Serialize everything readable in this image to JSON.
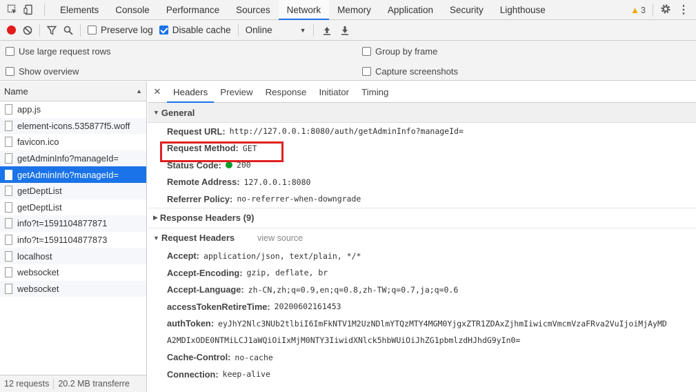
{
  "devtools": {
    "tabs": [
      "Elements",
      "Console",
      "Performance",
      "Sources",
      "Network",
      "Memory",
      "Application",
      "Security",
      "Lighthouse"
    ],
    "active_tab": "Network",
    "warning_count": "3"
  },
  "toolbar": {
    "preserve_log": "Preserve log",
    "disable_cache": "Disable cache",
    "throttle": "Online"
  },
  "settings": {
    "large_rows": "Use large request rows",
    "show_overview": "Show overview",
    "group_by_frame": "Group by frame",
    "capture_screenshots": "Capture screenshots"
  },
  "request_list": {
    "column": "Name",
    "items": [
      "app.js",
      "element-icons.535877f5.woff",
      "favicon.ico",
      "getAdminInfo?manageId=",
      "getAdminInfo?manageId=",
      "getDeptList",
      "getDeptList",
      "info?t=1591104877871",
      "info?t=1591104877873",
      "localhost",
      "websocket",
      "websocket"
    ],
    "selected_index": 4,
    "status_requests": "12 requests",
    "status_transferred": "20.2 MB transferre"
  },
  "detail": {
    "tabs": [
      "Headers",
      "Preview",
      "Response",
      "Initiator",
      "Timing"
    ],
    "active_tab": "Headers",
    "general_label": "General",
    "general": [
      {
        "name": "Request URL:",
        "value": "http://127.0.0.1:8080/auth/getAdminInfo?manageId="
      },
      {
        "name": "Request Method:",
        "value": "GET"
      },
      {
        "name": "Status Code:",
        "value": "200"
      },
      {
        "name": "Remote Address:",
        "value": "127.0.0.1:8080"
      },
      {
        "name": "Referrer Policy:",
        "value": "no-referrer-when-downgrade"
      }
    ],
    "response_headers_label": "Response Headers (9)",
    "request_headers_label": "Request Headers",
    "view_source": "view source",
    "request_headers": [
      {
        "name": "Accept:",
        "value": "application/json, text/plain, */*"
      },
      {
        "name": "Accept-Encoding:",
        "value": "gzip, deflate, br"
      },
      {
        "name": "Accept-Language:",
        "value": "zh-CN,zh;q=0.9,en;q=0.8,zh-TW;q=0.7,ja;q=0.6"
      },
      {
        "name": "accessTokenRetireTime:",
        "value": "20200602161453"
      },
      {
        "name": "authToken:",
        "value": "eyJhY2Nlc3NUb2tlbiI6ImFkNTV1M2UzNDlmYTQzMTY4MGM0YjgxZTR1ZDAxZjhmIiwicmVmcmVzaFRva2VuIjoiMjAyMD"
      },
      {
        "name": "",
        "value": "A2MDIxODE0NTMiLCJ1aWQiOiIxMjM0NTY3IiwidXNlck5hbWUiOiJhZG1pbmlzdHJhdG9yIn0="
      },
      {
        "name": "Cache-Control:",
        "value": "no-cache"
      },
      {
        "name": "Connection:",
        "value": "keep-alive"
      }
    ]
  },
  "colors": {
    "accent": "#1a73e8",
    "record": "#e21b1b",
    "highlight": "#e02020",
    "status_ok": "#0a9e28"
  }
}
